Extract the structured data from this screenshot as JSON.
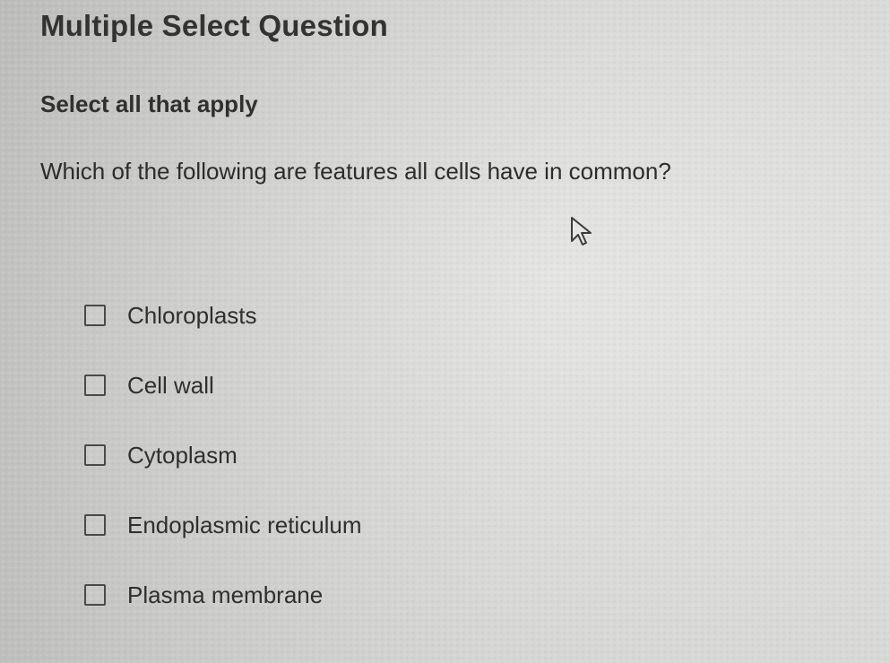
{
  "question": {
    "type_title": "Multiple Select Question",
    "instruction": "Select all that apply",
    "prompt": "Which of the following are features all cells have in common?"
  },
  "options": [
    {
      "label": "Chloroplasts",
      "checked": false
    },
    {
      "label": "Cell wall",
      "checked": false
    },
    {
      "label": "Cytoplasm",
      "checked": false
    },
    {
      "label": "Endoplasmic reticulum",
      "checked": false
    },
    {
      "label": "Plasma membrane",
      "checked": false
    }
  ],
  "icons": {
    "checkbox": "empty-checkbox-icon",
    "cursor": "mouse-pointer-icon"
  },
  "colors": {
    "background": "#d9d9d7",
    "text": "#2f2f2f",
    "checkbox_border": "#4a4a4a"
  }
}
